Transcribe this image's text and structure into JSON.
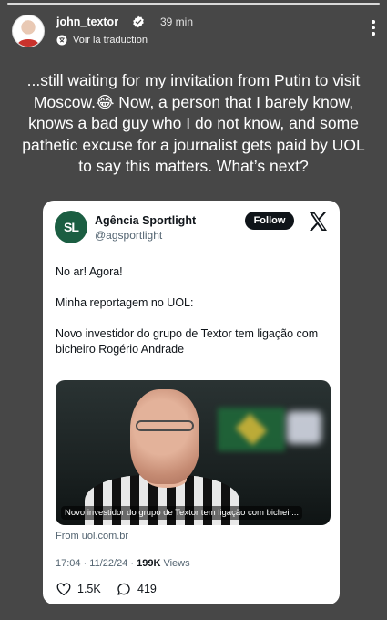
{
  "story": {
    "username": "john_textor",
    "time_ago": "39 min",
    "translate_label": "Voir la traduction",
    "caption": "...still waiting for my invitation from Putin to visit Moscow.😂 Now, a person that I barely know, knows a bad guy who I do not know, and some pathetic excuse for a journalist gets paid by UOL to say this matters. What’s next?"
  },
  "tweet": {
    "logo_text": "SL",
    "account_name": "Agência Sportlight",
    "handle": "@agsportlight",
    "follow_label": "Follow",
    "paragraphs": [
      "No ar! Agora!",
      "Minha reportagem no UOL:",
      "Novo investidor do grupo de Textor tem ligação com bicheiro Rogério Andrade"
    ],
    "media_caption": "Novo investidor do grupo de Textor tem ligação com bicheir...",
    "link_source": "From uol.com.br",
    "timestamp": "17:04 · 11/22/24 · ",
    "views_count": "199K",
    "views_label": " Views",
    "likes": "1.5K",
    "replies": "419"
  },
  "icons": [
    "verified-badge-icon",
    "translate-icon",
    "more-options-icon",
    "x-logo-icon",
    "heart-icon",
    "reply-icon"
  ]
}
